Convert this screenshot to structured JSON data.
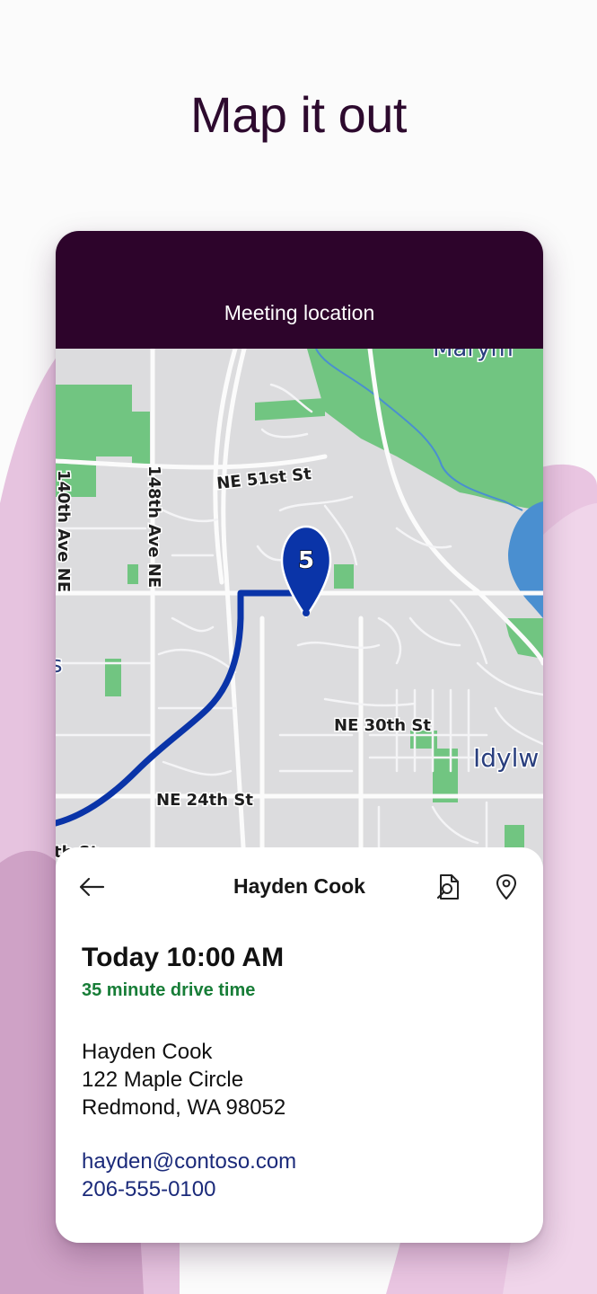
{
  "headline": "Map it out",
  "header": {
    "title": "Meeting location"
  },
  "map": {
    "labels": {
      "ne_51st": "NE 51st St",
      "ne_30th": "NE 30th St",
      "ne_24th": "NE 24th St",
      "ave_148th": "148th Ave NE",
      "ave_140th": "140th Ave NE",
      "marymoor": "Marym",
      "idylwood": "Idylw",
      "partial_st": "th St",
      "partial_s": "s"
    },
    "pin": {
      "number": "5",
      "color": "#0a34a8"
    },
    "route_color": "#0a34a8"
  },
  "details": {
    "name": "Hayden Cook",
    "time": "Today 10:00 AM",
    "drive_time": "35 minute drive time",
    "address": [
      "Hayden Cook",
      "122 Maple Circle",
      "Redmond, WA 98052"
    ],
    "email": "hayden@contoso.com",
    "phone": "206-555-0100"
  },
  "colors": {
    "header_bg": "#2d042b",
    "drive_time": "#177d37",
    "link": "#1b2a7a",
    "park": "#71c581",
    "water": "#4a8fd0"
  }
}
